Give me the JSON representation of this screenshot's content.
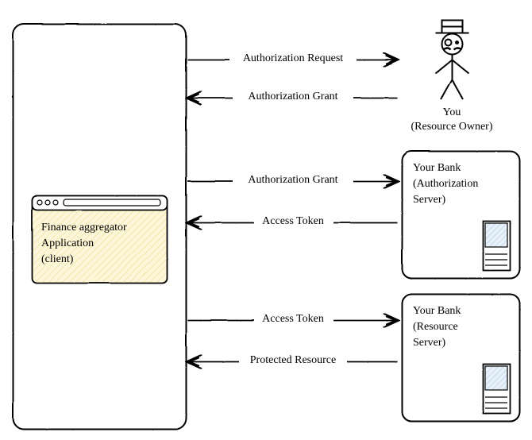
{
  "actors": {
    "client": {
      "title_line1": "Finance aggregator",
      "title_line2": "Application",
      "title_line3": "(client)"
    },
    "owner": {
      "title_line1": "You",
      "title_line2": "(Resource Owner)"
    },
    "auth_server": {
      "title_line1": "Your Bank",
      "title_line2": "(Authorization",
      "title_line3": "Server)"
    },
    "resource_server": {
      "title_line1": "Your Bank",
      "title_line2": "(Resource",
      "title_line3": "Server)"
    }
  },
  "arrows": {
    "a1": "Authorization Request",
    "a2": "Authorization Grant",
    "a3": "Authorization Grant",
    "a4": "Access Token",
    "a5": "Access Token",
    "a6": "Protected Resource"
  }
}
